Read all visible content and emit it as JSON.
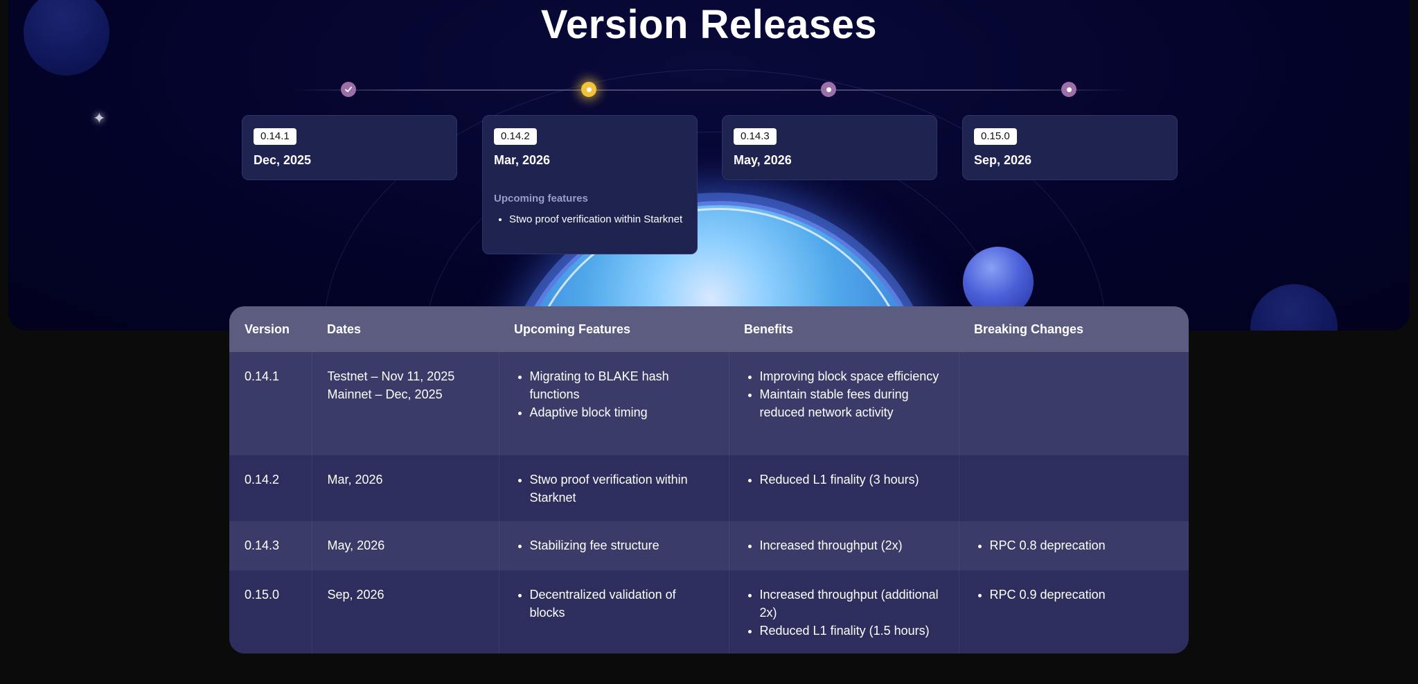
{
  "title": "Version Releases",
  "timeline": [
    {
      "version": "0.14.1",
      "date": "Dec, 2025",
      "status": "completed"
    },
    {
      "version": "0.14.2",
      "date": "Mar, 2026",
      "status": "current",
      "subtitle": "Upcoming features",
      "features": [
        "Stwo proof verification within Starknet"
      ]
    },
    {
      "version": "0.14.3",
      "date": "May, 2026",
      "status": "planned"
    },
    {
      "version": "0.15.0",
      "date": "Sep, 2026",
      "status": "planned"
    }
  ],
  "table": {
    "headers": [
      "Version",
      "Dates",
      "Upcoming Features",
      "Benefits",
      "Breaking Changes"
    ],
    "rows": [
      {
        "version": "0.14.1",
        "dates": [
          "Testnet – Nov 11, 2025",
          "Mainnet – Dec, 2025"
        ],
        "features": [
          "Migrating to BLAKE hash functions",
          "Adaptive block timing"
        ],
        "benefits": [
          "Improving block space efficiency",
          "Maintain stable fees during reduced network activity"
        ],
        "breaking": []
      },
      {
        "version": "0.14.2",
        "dates": [
          "Mar, 2026"
        ],
        "features": [
          "Stwo proof verification within Starknet"
        ],
        "benefits": [
          "Reduced L1 finality (3 hours)"
        ],
        "breaking": []
      },
      {
        "version": "0.14.3",
        "dates": [
          "May, 2026"
        ],
        "features": [
          "Stabilizing fee structure"
        ],
        "benefits": [
          "Increased throughput (2x)"
        ],
        "breaking": [
          "RPC 0.8 deprecation"
        ]
      },
      {
        "version": "0.15.0",
        "dates": [
          "Sep, 2026"
        ],
        "features": [
          "Decentralized validation of blocks"
        ],
        "benefits": [
          "Increased throughput (additional 2x)",
          "Reduced L1 finality (1.5 hours)"
        ],
        "breaking": [
          "RPC 0.9 deprecation"
        ]
      }
    ]
  },
  "colors": {
    "accent": "#f2c23b",
    "dot": "#9b6fa8",
    "card_bg": "#1f2350",
    "table_header": "#5b5c80",
    "page_bg": "#0b0b0b"
  },
  "icons": {
    "completed": "check-icon",
    "current": "dot-icon",
    "planned": "dot-icon"
  }
}
